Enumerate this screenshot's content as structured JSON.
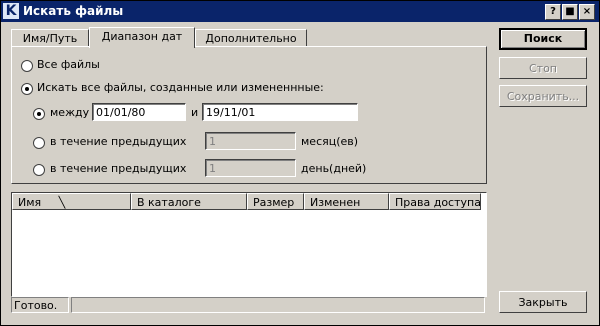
{
  "window": {
    "title": "Искать файлы",
    "controls": [
      "?",
      "■",
      "×"
    ]
  },
  "tabs": [
    {
      "label": "Имя/Путь"
    },
    {
      "label": "Диапазон дат"
    },
    {
      "label": "Дополнительно"
    }
  ],
  "date_range": {
    "all_files": "Все файлы",
    "find_all_label": "Искать все файлы, созданные или измененнные:",
    "between_label": "между",
    "between_from": "01/01/80",
    "and_label": "и",
    "between_to": "19/11/01",
    "prev_label_1": "в течение предыдущих",
    "months_value": "1",
    "months_unit": "месяц(ев)",
    "prev_label_2": "в течение предыдущих",
    "days_value": "1",
    "days_unit": "день(дней)"
  },
  "results": {
    "columns": [
      "Имя",
      "В каталоге",
      "Размер",
      "Изменен",
      "Права доступа"
    ],
    "sort_indicator": "╲"
  },
  "status": {
    "text": "Готово.",
    "extra": ""
  },
  "buttons": {
    "search": "Поиск",
    "stop": "Стоп",
    "save": "Сохранить...",
    "close": "Закрыть"
  }
}
